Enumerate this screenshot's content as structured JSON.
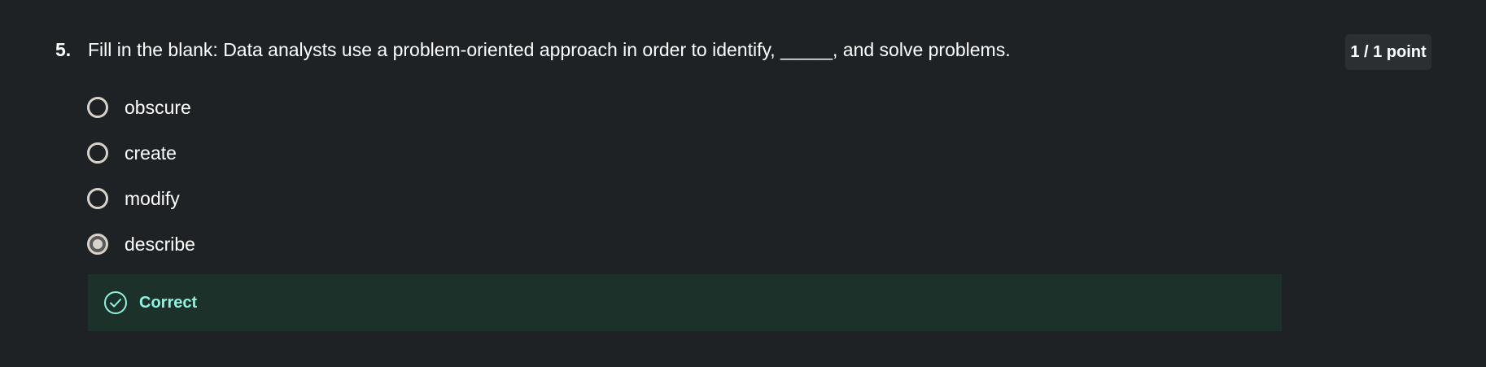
{
  "question": {
    "number": "5.",
    "text": "Fill in the blank: Data analysts use a problem-oriented approach in order to identify, _____, and solve problems.",
    "score": "1 / 1 point"
  },
  "options": [
    {
      "label": "obscure",
      "selected": false
    },
    {
      "label": "create",
      "selected": false
    },
    {
      "label": "modify",
      "selected": false
    },
    {
      "label": "describe",
      "selected": true
    }
  ],
  "feedback": {
    "text": "Correct",
    "icon": "check-circle-icon"
  },
  "colors": {
    "background": "#1f2224",
    "feedback_background": "#1b3129",
    "feedback_text": "#8ff3e0",
    "badge_background": "#2b2f32",
    "radio_border": "#d8d2cb"
  }
}
